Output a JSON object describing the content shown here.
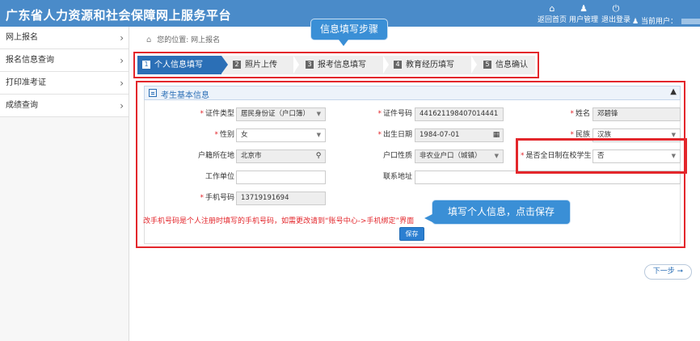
{
  "header": {
    "title": "广东省人力资源和社会保障网上服务平台",
    "nav": [
      {
        "icon": "home-icon",
        "glyph": "⌂",
        "label": "返回首页"
      },
      {
        "icon": "user-icon",
        "glyph": "👤",
        "label": "用户管理"
      },
      {
        "icon": "power-icon",
        "glyph": "⏻",
        "label": "退出登录"
      }
    ],
    "current_user_label": "当前用户："
  },
  "sidebar": {
    "items": [
      {
        "label": "网上报名"
      },
      {
        "label": "报名信息查询"
      },
      {
        "label": "打印准考证"
      },
      {
        "label": "成绩查询"
      }
    ]
  },
  "breadcrumb": {
    "prefix": "您的位置:",
    "current": "网上报名"
  },
  "callouts": {
    "steps": "信息填写步骤",
    "fill": "填写个人信息，点击保存"
  },
  "steps": [
    {
      "num": "1",
      "label": "个人信息填写",
      "active": true
    },
    {
      "num": "2",
      "label": "照片上传",
      "active": false
    },
    {
      "num": "3",
      "label": "报考信息填写",
      "active": false
    },
    {
      "num": "4",
      "label": "教育经历填写",
      "active": false
    },
    {
      "num": "5",
      "label": "信息确认",
      "active": false
    }
  ],
  "form": {
    "section_title": "考生基本信息",
    "id_type_label": "证件类型",
    "id_type_value": "居民身份证（户口簿）",
    "id_number_label": "证件号码",
    "id_number_value": "441621198407014441",
    "name_label": "姓名",
    "name_value": "邓碧锋",
    "gender_label": "性别",
    "gender_value": "女",
    "birth_label": "出生日期",
    "birth_value": "1984-07-01",
    "ethnic_label": "民族",
    "ethnic_value": "汉族",
    "hukou_place_label": "户籍所在地",
    "hukou_place_value": "北京市",
    "hukou_type_label": "户口性质",
    "hukou_type_value": "非农业户口（城镇）",
    "fulltime_label": "是否全日制在校学生",
    "fulltime_value": "否",
    "work_unit_label": "工作单位",
    "work_unit_value": "",
    "address_label": "联系地址",
    "address_value": "",
    "phone_label": "手机号码",
    "phone_value": "13719191694"
  },
  "note": "改手机号码是个人注册时填写的手机号码，如需更改请到“账号中心->手机绑定”界面",
  "save_label": "保存",
  "next_label": "下一步 ➞",
  "colors": {
    "header": "#4a8bc9",
    "accent": "#2b6fb6",
    "highlight": "#e3262b",
    "callout": "#3a8fd6"
  }
}
